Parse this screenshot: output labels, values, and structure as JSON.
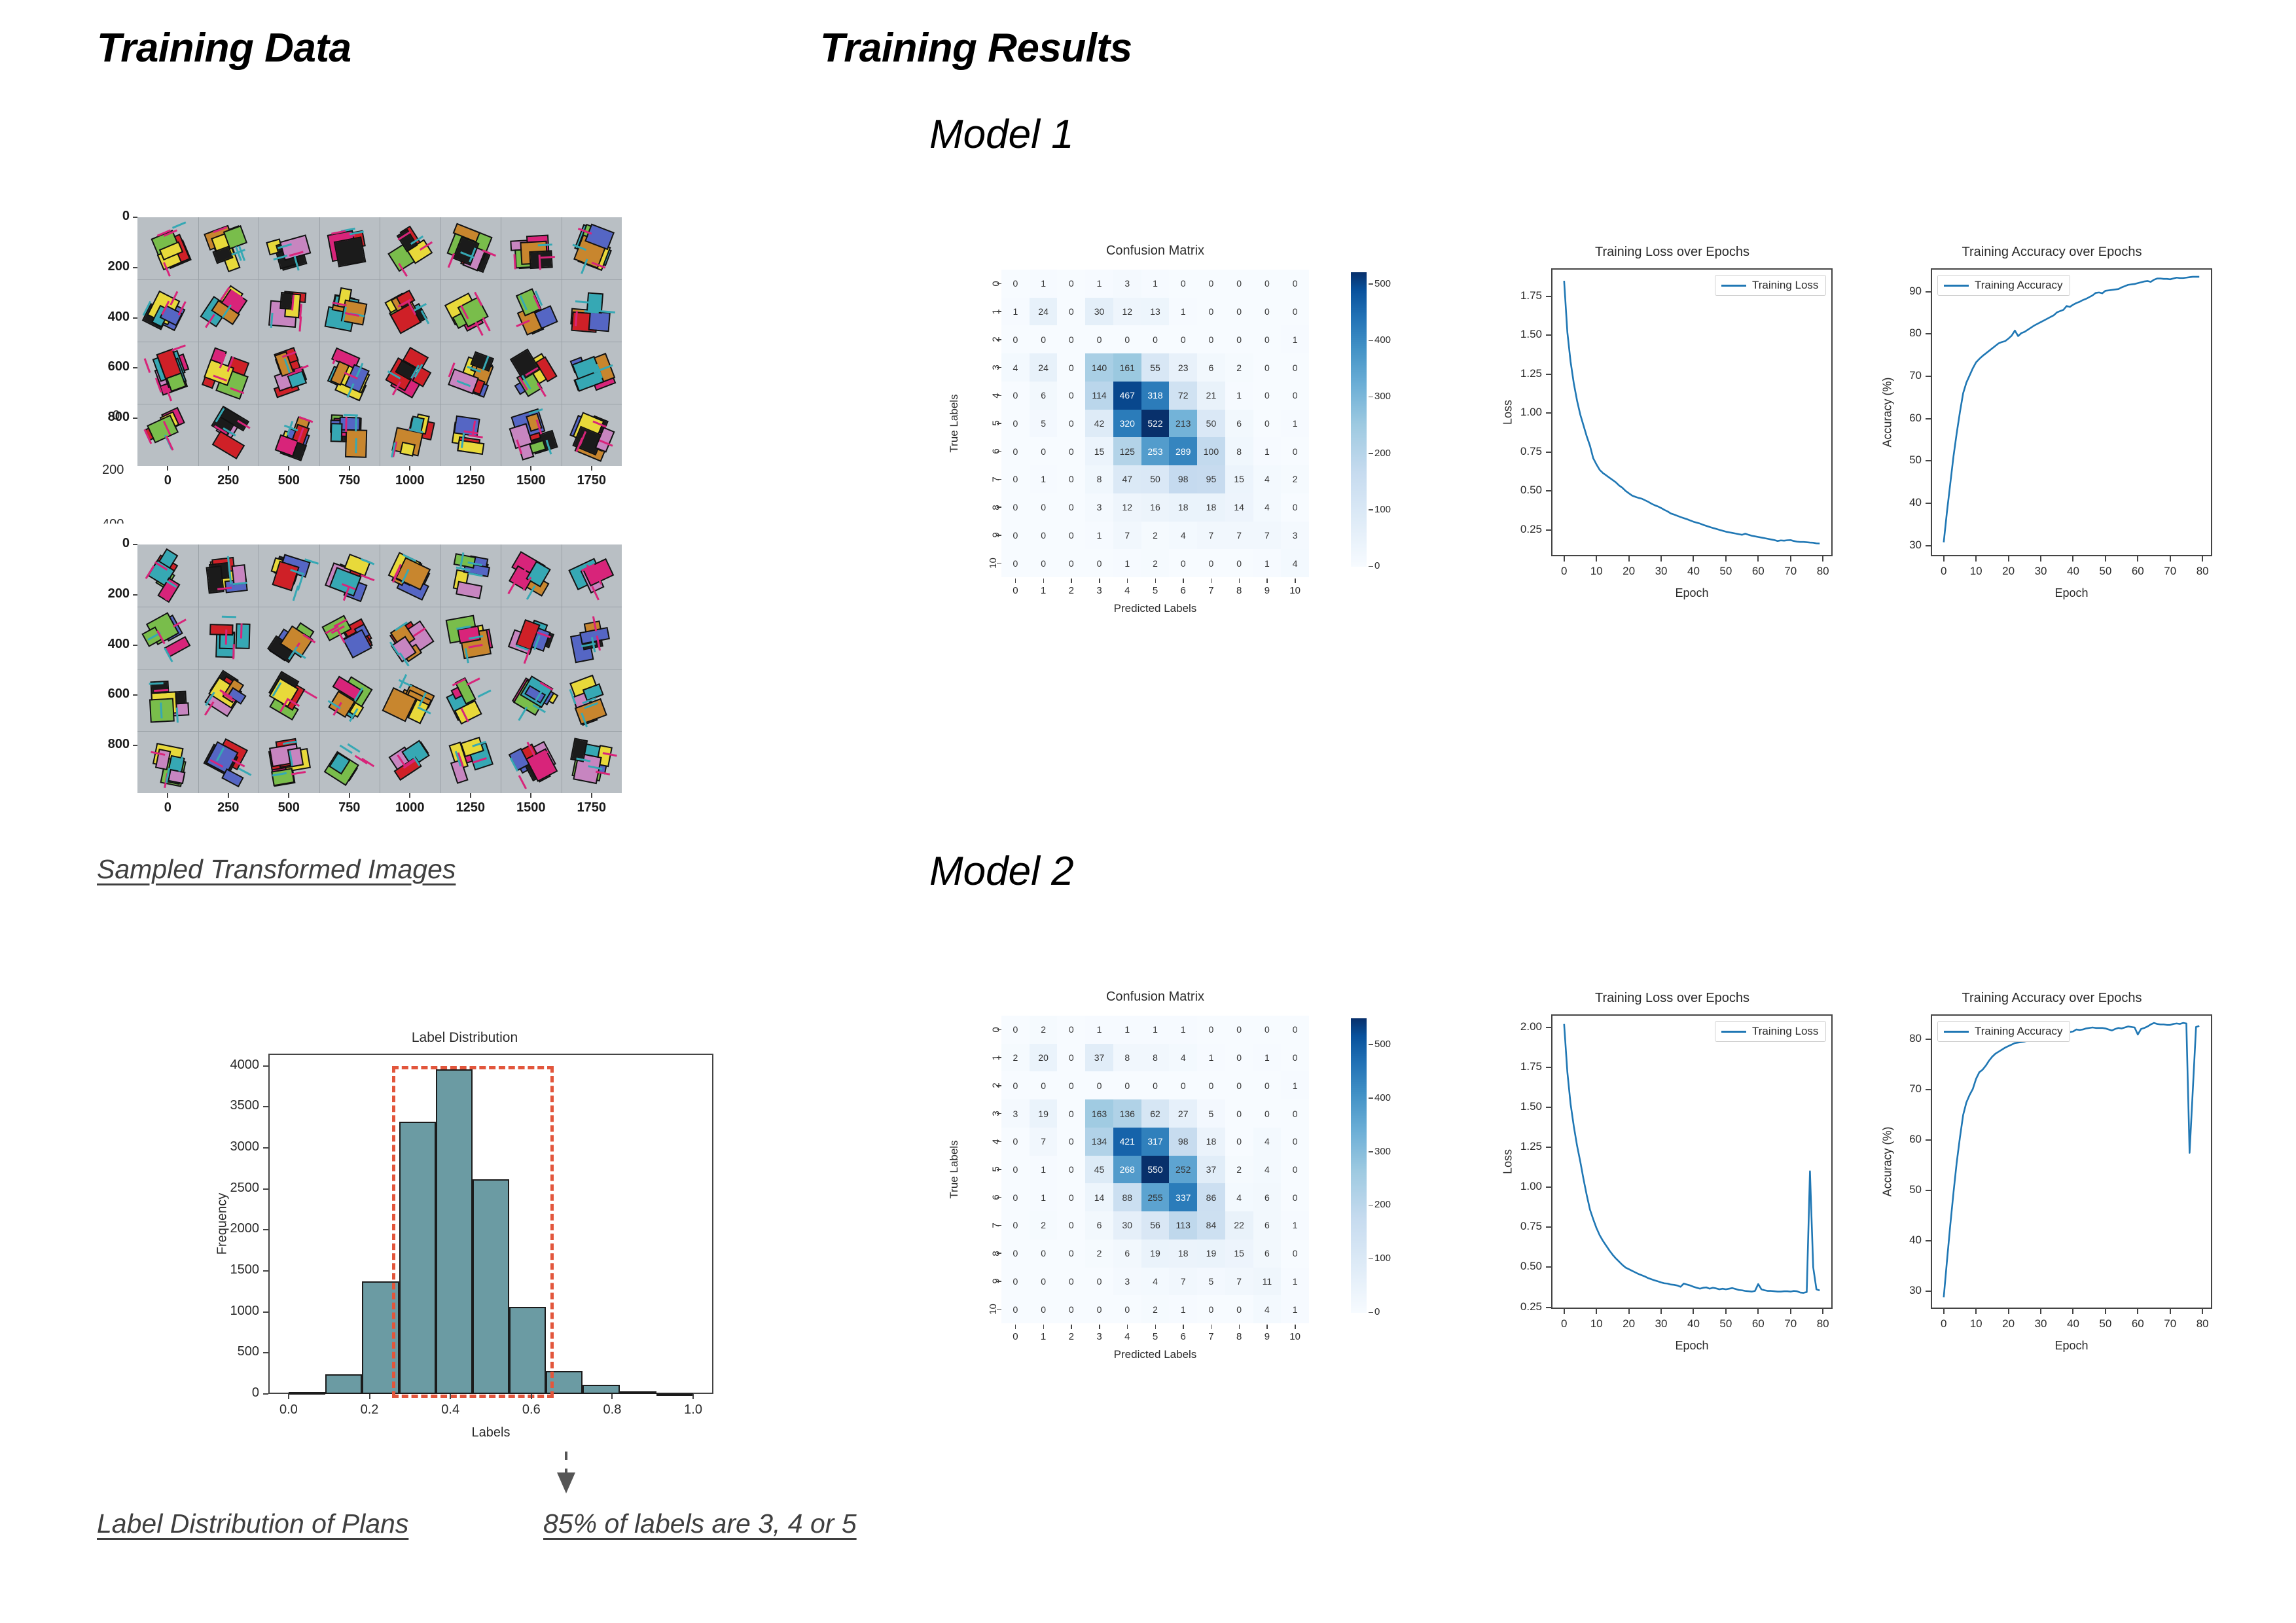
{
  "headings": {
    "training_data": "Training Data",
    "training_results": "Training Results",
    "model1": "Model 1",
    "model2": "Model 2"
  },
  "captions": {
    "sampled_images": "Sampled Transformed Images",
    "label_distribution": "Label Distribution of Plans",
    "insight": "85% of labels are 3, 4 or 5"
  },
  "colors": {
    "line": "#1f77b4",
    "histogram_bar": "#6b9ba3",
    "highlight_box": "#e2563c",
    "heatmap_low": "#f7fbff",
    "heatmap_high": "#08306b",
    "image_background": "#b9bfc4"
  },
  "image_grids": [
    {
      "name": "sampled-transformed-images-grid-top",
      "xticks": [
        "0",
        "250",
        "500",
        "750",
        "1000",
        "1250",
        "1500",
        "1750"
      ],
      "yticks": [
        "0",
        "200",
        "400",
        "600",
        "800"
      ],
      "rows": 4,
      "cols": 8
    },
    {
      "name": "sampled-transformed-images-grid-bottom",
      "xticks": [
        "0",
        "250",
        "500",
        "750",
        "1000",
        "1250",
        "1500",
        "1750"
      ],
      "yticks": [
        "0",
        "200",
        "400",
        "600",
        "800"
      ],
      "rows": 4,
      "cols": 8
    }
  ],
  "chart_data": [
    {
      "id": "label_distribution",
      "type": "bar",
      "title": "Label Distribution",
      "xlabel": "Labels",
      "ylabel": "Frequency",
      "xlim": [
        -0.05,
        1.05
      ],
      "ylim": [
        0,
        4150
      ],
      "xticks": [
        "0.0",
        "0.2",
        "0.4",
        "0.6",
        "0.8",
        "1.0"
      ],
      "yticks": [
        "0",
        "500",
        "1000",
        "1500",
        "2000",
        "2500",
        "3000",
        "3500",
        "4000"
      ],
      "bin_edges": [
        0.0,
        0.091,
        0.182,
        0.273,
        0.364,
        0.455,
        0.545,
        0.636,
        0.727,
        0.818,
        0.909,
        1.0
      ],
      "values": [
        20,
        240,
        1370,
        3320,
        3960,
        2620,
        1060,
        280,
        110,
        35,
        10
      ],
      "highlight_region": [
        0.255,
        0.655
      ],
      "highlight_note": "dashed red rectangle covering bins with labels 3, 4 and 5"
    },
    {
      "id": "model1_confusion_matrix",
      "type": "heatmap",
      "title": "Confusion Matrix",
      "xlabel": "Predicted Labels",
      "ylabel": "True Labels",
      "xticks": [
        "0",
        "1",
        "2",
        "3",
        "4",
        "5",
        "6",
        "7",
        "8",
        "9",
        "10"
      ],
      "yticks": [
        "0",
        "1",
        "2",
        "3",
        "4",
        "5",
        "6",
        "7",
        "8",
        "9",
        "10"
      ],
      "colorbar_ticks": [
        "0",
        "100",
        "200",
        "300",
        "400",
        "500"
      ],
      "vmin": 0,
      "vmax": 522,
      "matrix": [
        [
          0,
          1,
          0,
          1,
          3,
          1,
          0,
          0,
          0,
          0,
          0
        ],
        [
          1,
          24,
          0,
          30,
          12,
          13,
          1,
          0,
          0,
          0,
          0
        ],
        [
          0,
          0,
          0,
          0,
          0,
          0,
          0,
          0,
          0,
          0,
          1
        ],
        [
          4,
          24,
          0,
          140,
          161,
          55,
          23,
          6,
          2,
          0,
          0
        ],
        [
          0,
          6,
          0,
          114,
          467,
          318,
          72,
          21,
          1,
          0,
          0
        ],
        [
          0,
          5,
          0,
          42,
          320,
          522,
          213,
          50,
          6,
          0,
          1
        ],
        [
          0,
          0,
          0,
          15,
          125,
          253,
          289,
          100,
          8,
          1,
          0
        ],
        [
          0,
          1,
          0,
          8,
          47,
          50,
          98,
          95,
          15,
          4,
          2
        ],
        [
          0,
          0,
          0,
          3,
          12,
          16,
          18,
          18,
          14,
          4,
          0
        ],
        [
          0,
          0,
          0,
          1,
          7,
          2,
          4,
          7,
          7,
          7,
          3
        ],
        [
          0,
          0,
          0,
          0,
          1,
          2,
          0,
          0,
          0,
          1,
          4
        ]
      ]
    },
    {
      "id": "model1_training_loss",
      "type": "line",
      "title": "Training Loss over Epochs",
      "xlabel": "Epoch",
      "ylabel": "Loss",
      "legend": [
        "Training Loss"
      ],
      "legend_position": "upper right",
      "xticks": [
        "0",
        "10",
        "20",
        "30",
        "40",
        "50",
        "60",
        "70",
        "80"
      ],
      "yticks": [
        "0.25",
        "0.50",
        "0.75",
        "1.00",
        "1.25",
        "1.50",
        "1.75"
      ],
      "xlim": [
        -4,
        83
      ],
      "ylim": [
        0.08,
        1.93
      ],
      "x": [
        0,
        1,
        2,
        3,
        4,
        5,
        6,
        7,
        8,
        9,
        10,
        11,
        12,
        13,
        14,
        15,
        16,
        17,
        18,
        19,
        20,
        21,
        22,
        23,
        24,
        25,
        26,
        27,
        28,
        29,
        30,
        31,
        32,
        33,
        34,
        35,
        36,
        37,
        38,
        39,
        40,
        41,
        42,
        43,
        44,
        45,
        46,
        47,
        48,
        49,
        50,
        51,
        52,
        53,
        54,
        55,
        56,
        57,
        58,
        59,
        60,
        61,
        62,
        63,
        64,
        65,
        66,
        67,
        68,
        69,
        70,
        71,
        72,
        73,
        74,
        75,
        76,
        77,
        78,
        79
      ],
      "y": [
        1.85,
        1.52,
        1.33,
        1.19,
        1.08,
        0.99,
        0.92,
        0.85,
        0.79,
        0.71,
        0.67,
        0.635,
        0.615,
        0.6,
        0.585,
        0.57,
        0.555,
        0.535,
        0.52,
        0.5,
        0.485,
        0.47,
        0.462,
        0.455,
        0.45,
        0.44,
        0.43,
        0.418,
        0.408,
        0.4,
        0.39,
        0.378,
        0.368,
        0.355,
        0.348,
        0.34,
        0.332,
        0.325,
        0.318,
        0.31,
        0.302,
        0.296,
        0.29,
        0.282,
        0.275,
        0.268,
        0.262,
        0.256,
        0.25,
        0.244,
        0.238,
        0.234,
        0.23,
        0.226,
        0.222,
        0.218,
        0.225,
        0.218,
        0.212,
        0.208,
        0.204,
        0.2,
        0.196,
        0.192,
        0.188,
        0.184,
        0.178,
        0.182,
        0.18,
        0.183,
        0.184,
        0.178,
        0.174,
        0.172,
        0.172,
        0.17,
        0.168,
        0.167,
        0.163,
        0.162
      ]
    },
    {
      "id": "model1_training_accuracy",
      "type": "line",
      "title": "Training Accuracy over Epochs",
      "xlabel": "Epoch",
      "ylabel": "Accuracy (%)",
      "legend": [
        "Training Accuracy"
      ],
      "legend_position": "upper left",
      "xticks": [
        "0",
        "10",
        "20",
        "30",
        "40",
        "50",
        "60",
        "70",
        "80"
      ],
      "yticks": [
        "30",
        "40",
        "50",
        "60",
        "70",
        "80",
        "90"
      ],
      "xlim": [
        -4,
        83
      ],
      "ylim": [
        27.5,
        95.5
      ],
      "x": [
        0,
        1,
        2,
        3,
        4,
        5,
        6,
        7,
        8,
        9,
        10,
        11,
        12,
        13,
        14,
        15,
        16,
        17,
        18,
        19,
        20,
        21,
        22,
        23,
        24,
        25,
        26,
        27,
        28,
        29,
        30,
        31,
        32,
        33,
        34,
        35,
        36,
        37,
        38,
        39,
        40,
        41,
        42,
        43,
        44,
        45,
        46,
        47,
        48,
        49,
        50,
        51,
        52,
        53,
        54,
        55,
        56,
        57,
        58,
        59,
        60,
        61,
        62,
        63,
        64,
        65,
        66,
        67,
        68,
        69,
        70,
        71,
        72,
        73,
        74,
        75,
        76,
        77,
        78,
        79
      ],
      "y": [
        30.8,
        38.0,
        44.5,
        51.0,
        56.5,
        61.5,
        66.0,
        68.5,
        70.2,
        71.9,
        73.3,
        74.1,
        74.8,
        75.4,
        76.0,
        76.6,
        77.2,
        77.8,
        78.1,
        78.3,
        78.9,
        79.6,
        80.8,
        79.5,
        80.2,
        80.5,
        81.0,
        81.5,
        82.0,
        82.4,
        82.8,
        83.2,
        83.6,
        84.0,
        84.4,
        85.1,
        85.4,
        85.7,
        86.6,
        86.4,
        86.9,
        87.3,
        87.6,
        88.0,
        88.3,
        88.7,
        89.1,
        89.7,
        89.8,
        89.6,
        90.2,
        90.3,
        90.4,
        90.5,
        90.6,
        91.0,
        91.3,
        91.6,
        91.7,
        91.8,
        92.0,
        92.2,
        92.4,
        92.5,
        92.3,
        92.8,
        93.1,
        93.1,
        93.0,
        93.0,
        92.9,
        93.1,
        93.3,
        93.2,
        93.2,
        93.3,
        93.4,
        93.5,
        93.5,
        93.5
      ]
    },
    {
      "id": "model2_confusion_matrix",
      "type": "heatmap",
      "title": "Confusion Matrix",
      "xlabel": "Predicted Labels",
      "ylabel": "True Labels",
      "xticks": [
        "0",
        "1",
        "2",
        "3",
        "4",
        "5",
        "6",
        "7",
        "8",
        "9",
        "10"
      ],
      "yticks": [
        "0",
        "1",
        "2",
        "3",
        "4",
        "5",
        "6",
        "7",
        "8",
        "9",
        "10"
      ],
      "colorbar_ticks": [
        "0",
        "100",
        "200",
        "300",
        "400",
        "500"
      ],
      "vmin": 0,
      "vmax": 550,
      "matrix": [
        [
          0,
          2,
          0,
          1,
          1,
          1,
          1,
          0,
          0,
          0,
          0
        ],
        [
          2,
          20,
          0,
          37,
          8,
          8,
          4,
          1,
          0,
          1,
          0
        ],
        [
          0,
          0,
          0,
          0,
          0,
          0,
          0,
          0,
          0,
          0,
          1
        ],
        [
          3,
          19,
          0,
          163,
          136,
          62,
          27,
          5,
          0,
          0,
          0
        ],
        [
          0,
          7,
          0,
          134,
          421,
          317,
          98,
          18,
          0,
          4,
          0
        ],
        [
          0,
          1,
          0,
          45,
          268,
          550,
          252,
          37,
          2,
          4,
          0
        ],
        [
          0,
          1,
          0,
          14,
          88,
          255,
          337,
          86,
          4,
          6,
          0
        ],
        [
          0,
          2,
          0,
          6,
          30,
          56,
          113,
          84,
          22,
          6,
          1
        ],
        [
          0,
          0,
          0,
          2,
          6,
          19,
          18,
          19,
          15,
          6,
          0
        ],
        [
          0,
          0,
          0,
          0,
          3,
          4,
          7,
          5,
          7,
          11,
          1
        ],
        [
          0,
          0,
          0,
          0,
          0,
          2,
          1,
          0,
          0,
          4,
          1
        ]
      ]
    },
    {
      "id": "model2_training_loss",
      "type": "line",
      "title": "Training Loss over Epochs",
      "xlabel": "Epoch",
      "ylabel": "Loss",
      "legend": [
        "Training Loss"
      ],
      "legend_position": "upper right",
      "xticks": [
        "0",
        "10",
        "20",
        "30",
        "40",
        "50",
        "60",
        "70",
        "80"
      ],
      "yticks": [
        "0.25",
        "0.50",
        "0.75",
        "1.00",
        "1.25",
        "1.50",
        "1.75",
        "2.00"
      ],
      "xlim": [
        -4,
        83
      ],
      "ylim": [
        0.24,
        2.08
      ],
      "x": [
        0,
        1,
        2,
        3,
        4,
        5,
        6,
        7,
        8,
        9,
        10,
        11,
        12,
        13,
        14,
        15,
        16,
        17,
        18,
        19,
        20,
        21,
        22,
        23,
        24,
        25,
        26,
        27,
        28,
        29,
        30,
        31,
        32,
        33,
        34,
        35,
        36,
        37,
        38,
        39,
        40,
        41,
        42,
        43,
        44,
        45,
        46,
        47,
        48,
        49,
        50,
        51,
        52,
        53,
        54,
        55,
        56,
        57,
        58,
        59,
        60,
        61,
        62,
        63,
        64,
        65,
        66,
        67,
        68,
        69,
        70,
        71,
        72,
        73,
        74,
        75,
        76,
        77,
        78,
        79
      ],
      "y": [
        2.02,
        1.72,
        1.52,
        1.38,
        1.26,
        1.16,
        1.05,
        0.95,
        0.86,
        0.8,
        0.745,
        0.7,
        0.665,
        0.635,
        0.605,
        0.578,
        0.555,
        0.535,
        0.515,
        0.498,
        0.488,
        0.478,
        0.468,
        0.458,
        0.45,
        0.442,
        0.432,
        0.425,
        0.418,
        0.412,
        0.405,
        0.4,
        0.398,
        0.392,
        0.39,
        0.386,
        0.378,
        0.398,
        0.392,
        0.386,
        0.378,
        0.372,
        0.366,
        0.372,
        0.374,
        0.366,
        0.372,
        0.368,
        0.362,
        0.366,
        0.362,
        0.366,
        0.37,
        0.364,
        0.358,
        0.356,
        0.352,
        0.35,
        0.348,
        0.352,
        0.395,
        0.362,
        0.356,
        0.352,
        0.352,
        0.35,
        0.348,
        0.348,
        0.35,
        0.35,
        0.348,
        0.352,
        0.35,
        0.342,
        0.34,
        0.345,
        1.1,
        0.5,
        0.362,
        0.355
      ]
    },
    {
      "id": "model2_training_accuracy",
      "type": "line",
      "title": "Training Accuracy over Epochs",
      "xlabel": "Epoch",
      "ylabel": "Accuracy (%)",
      "legend": [
        "Training Accuracy"
      ],
      "legend_position": "upper left",
      "xticks": [
        "0",
        "10",
        "20",
        "30",
        "40",
        "50",
        "60",
        "70",
        "80"
      ],
      "yticks": [
        "30",
        "40",
        "50",
        "60",
        "70",
        "80"
      ],
      "xlim": [
        -4,
        83
      ],
      "ylim": [
        26.5,
        85.0
      ],
      "x": [
        0,
        1,
        2,
        3,
        4,
        5,
        6,
        7,
        8,
        9,
        10,
        11,
        12,
        13,
        14,
        15,
        16,
        17,
        18,
        19,
        20,
        21,
        22,
        23,
        24,
        25,
        26,
        27,
        28,
        29,
        30,
        31,
        32,
        33,
        34,
        35,
        36,
        37,
        38,
        39,
        40,
        41,
        42,
        43,
        44,
        45,
        46,
        47,
        48,
        49,
        50,
        51,
        52,
        53,
        54,
        55,
        56,
        57,
        58,
        59,
        60,
        61,
        62,
        63,
        64,
        65,
        66,
        67,
        68,
        69,
        70,
        71,
        72,
        73,
        74,
        75,
        76,
        77,
        78,
        79
      ],
      "y": [
        28.8,
        36.0,
        43.0,
        49.5,
        55.5,
        60.5,
        65.0,
        67.5,
        69.0,
        70.2,
        72.2,
        73.5,
        74.0,
        74.8,
        75.8,
        76.6,
        77.2,
        77.6,
        78.0,
        78.4,
        78.7,
        79.0,
        79.3,
        79.4,
        79.5,
        79.6,
        79.8,
        80.0,
        80.2,
        80.5,
        80.2,
        80.4,
        80.5,
        80.6,
        80.7,
        80.8,
        80.9,
        81.1,
        81.3,
        81.5,
        81.6,
        82.0,
        81.9,
        82.0,
        82.2,
        82.3,
        82.4,
        82.3,
        82.3,
        82.3,
        82.2,
        82.0,
        81.8,
        82.1,
        82.3,
        82.2,
        82.4,
        82.6,
        82.5,
        82.4,
        81.0,
        82.1,
        82.3,
        82.6,
        83.0,
        83.3,
        83.1,
        83.0,
        83.0,
        82.9,
        82.9,
        83.1,
        83.2,
        83.1,
        83.3,
        83.2,
        57.5,
        70.0,
        82.5,
        82.7
      ]
    }
  ]
}
